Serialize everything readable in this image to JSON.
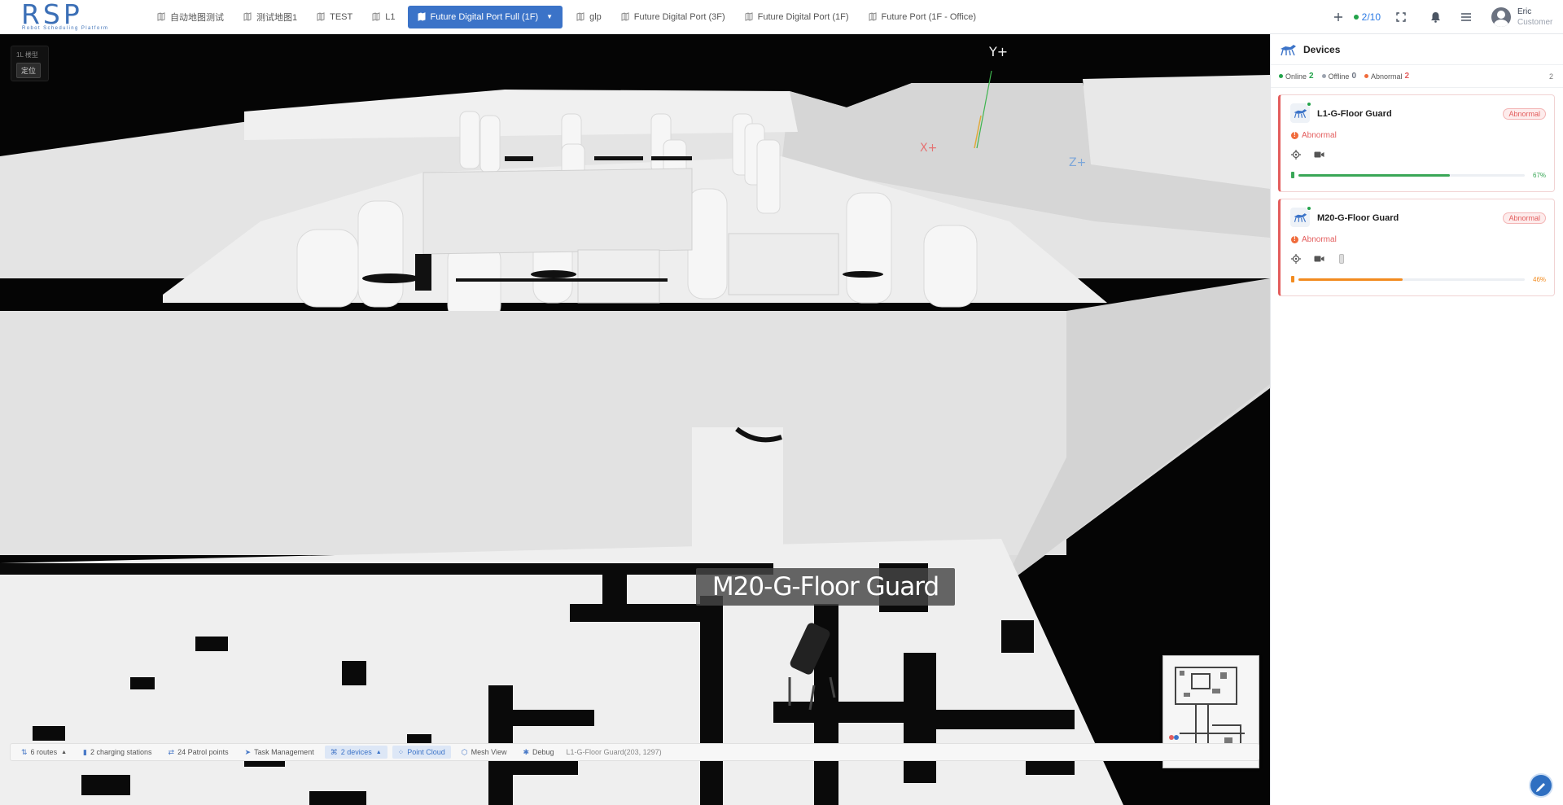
{
  "app": {
    "logo_text": "RSP",
    "logo_subtitle": "Robot Scheduling Platform"
  },
  "tabs": [
    {
      "label": "自动地图测试",
      "active": false
    },
    {
      "label": "测试地图1",
      "active": false
    },
    {
      "label": "TEST",
      "active": false
    },
    {
      "label": "L1",
      "active": false
    },
    {
      "label": "Future Digital Port Full (1F)",
      "active": true
    },
    {
      "label": "glp",
      "active": false
    },
    {
      "label": "Future Digital Port (3F)",
      "active": false
    },
    {
      "label": "Future Digital Port (1F)",
      "active": false
    },
    {
      "label": "Future Port (1F - Office)",
      "active": false
    }
  ],
  "header": {
    "add_icon": "plus-icon",
    "robot_count": "2/10",
    "fullscreen_icon": "fullscreen-icon",
    "bell_icon": "bell-icon",
    "menu_icon": "menu-icon",
    "user_name": "Eric",
    "user_role": "Customer"
  },
  "viewport": {
    "mode_label": "1L 楼型",
    "mode_button": "定位",
    "axis_y": "Y+",
    "axis_x": "X+",
    "axis_z": "Z+",
    "robot_label": "M20-G-Floor Guard"
  },
  "toolbar": {
    "routes": "6 routes",
    "charging": "2 charging stations",
    "patrol": "24 Patrol points",
    "task": "Task Management",
    "devices": "2 devices",
    "point_cloud": "Point Cloud",
    "mesh_view": "Mesh View",
    "debug": "Debug",
    "coord": "L1-G-Floor Guard(203, 1297)"
  },
  "panel": {
    "title": "Devices",
    "online_label": "Online",
    "online_count": "2",
    "offline_label": "Offline",
    "offline_count": "0",
    "abnormal_label": "Abnormal",
    "abnormal_count": "2",
    "total": "2",
    "devices": [
      {
        "name": "L1-G-Floor Guard",
        "badge": "Abnormal",
        "status": "Abnormal",
        "battery": "67%",
        "battery_value": 67,
        "battery_color": "#3aa757"
      },
      {
        "name": "M20-G-Floor Guard",
        "badge": "Abnormal",
        "status": "Abnormal",
        "battery": "46%",
        "battery_value": 46,
        "battery_color": "#f28b1f"
      }
    ]
  },
  "colors": {
    "accent": "#3b73c8",
    "online": "#22a34a",
    "offline": "#9ca3af",
    "abnormal": "#e35d5d"
  }
}
